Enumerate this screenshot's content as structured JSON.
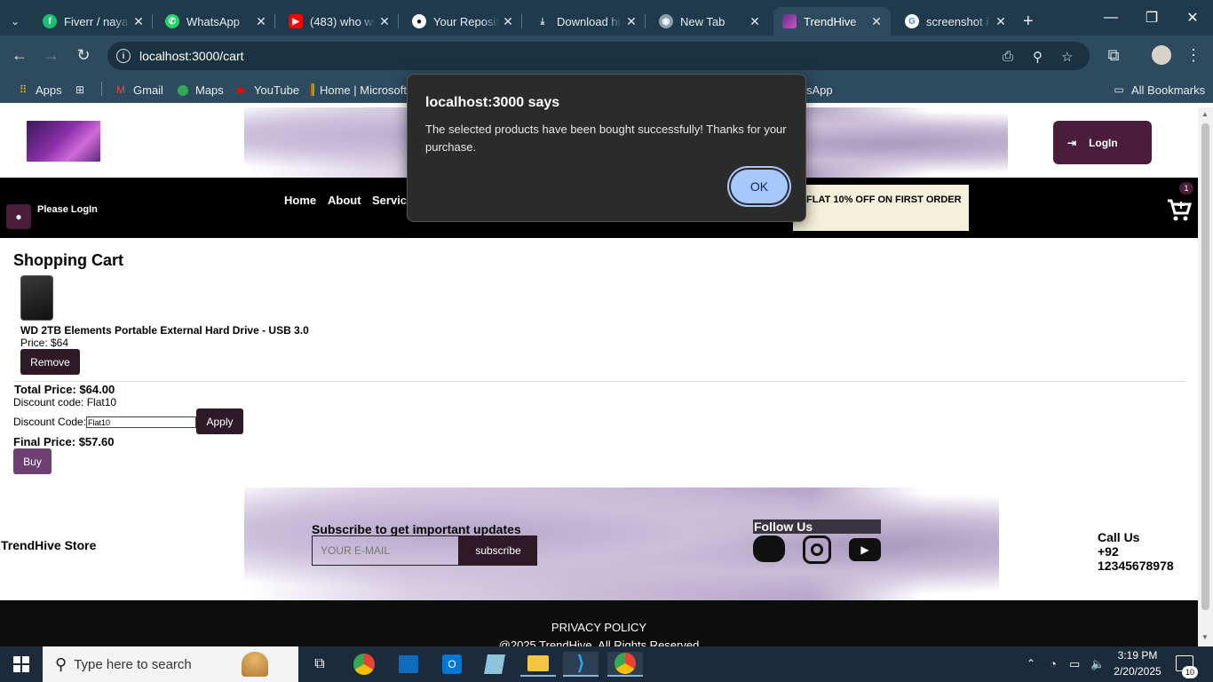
{
  "browser": {
    "tabs": [
      {
        "title": "Fiverr / nayab",
        "icon": "fiverr-icon"
      },
      {
        "title": "WhatsApp",
        "icon": "whatsapp-icon"
      },
      {
        "title": "(483) who wi",
        "icon": "youtube-icon"
      },
      {
        "title": "Your Reposit",
        "icon": "github-icon"
      },
      {
        "title": "Download hi",
        "icon": "download-icon"
      },
      {
        "title": "New Tab",
        "icon": "chrome-icon"
      },
      {
        "title": "TrendHive",
        "icon": "trendhive-icon",
        "active": true
      },
      {
        "title": "screenshot i",
        "icon": "google-icon"
      }
    ],
    "url": "localhost:3000/cart",
    "bookmarks": [
      {
        "label": "Apps",
        "icon": "apps-grid-icon"
      },
      {
        "label": "",
        "icon": "tiles-icon"
      },
      {
        "label": "Gmail",
        "icon": "gmail-icon"
      },
      {
        "label": "Maps",
        "icon": "maps-icon"
      },
      {
        "label": "YouTube",
        "icon": "youtube-icon"
      },
      {
        "label": "Home | Microsoft",
        "icon": "microsoft-icon"
      },
      {
        "label": "sApp",
        "icon": ""
      }
    ],
    "all_bookmarks": "All Bookmarks"
  },
  "dialog": {
    "title": "localhost:3000 says",
    "message": "The selected products have been bought successfully! Thanks for your purchase.",
    "ok": "OK"
  },
  "header": {
    "login": "LogIn",
    "user_status": "Please LogIn",
    "nav": [
      "Home",
      "About",
      "Service"
    ],
    "promo": "FLAT 10% OFF ON FIRST ORDER",
    "cart_count": "1"
  },
  "cart": {
    "title": "Shopping Cart",
    "item": {
      "name": "WD 2TB Elements Portable External Hard Drive - USB 3.0",
      "price": "Price: $64",
      "remove": "Remove"
    },
    "total": "Total Price: $64.00",
    "discount_info": "Discount code: Flat10",
    "discount_label": "Discount Code:",
    "discount_value": "Flat10",
    "apply": "Apply",
    "final": "Final Price: $57.60",
    "buy": "Buy"
  },
  "footer": {
    "store": "TrendHive Store",
    "subscribe_title": "Subscribe to get important updates",
    "email_placeholder": "YOUR E-MAIL",
    "subscribe_btn": "subscribe",
    "follow": "Follow Us",
    "call_title": "Call Us",
    "phone": "+92 12345678978",
    "privacy": "PRIVACY POLICY",
    "copyright": "@2025 TrendHive. All Rights Reserved"
  },
  "taskbar": {
    "search_placeholder": "Type here to search",
    "time": "3:19 PM",
    "date": "2/20/2025",
    "notifications": "10"
  }
}
